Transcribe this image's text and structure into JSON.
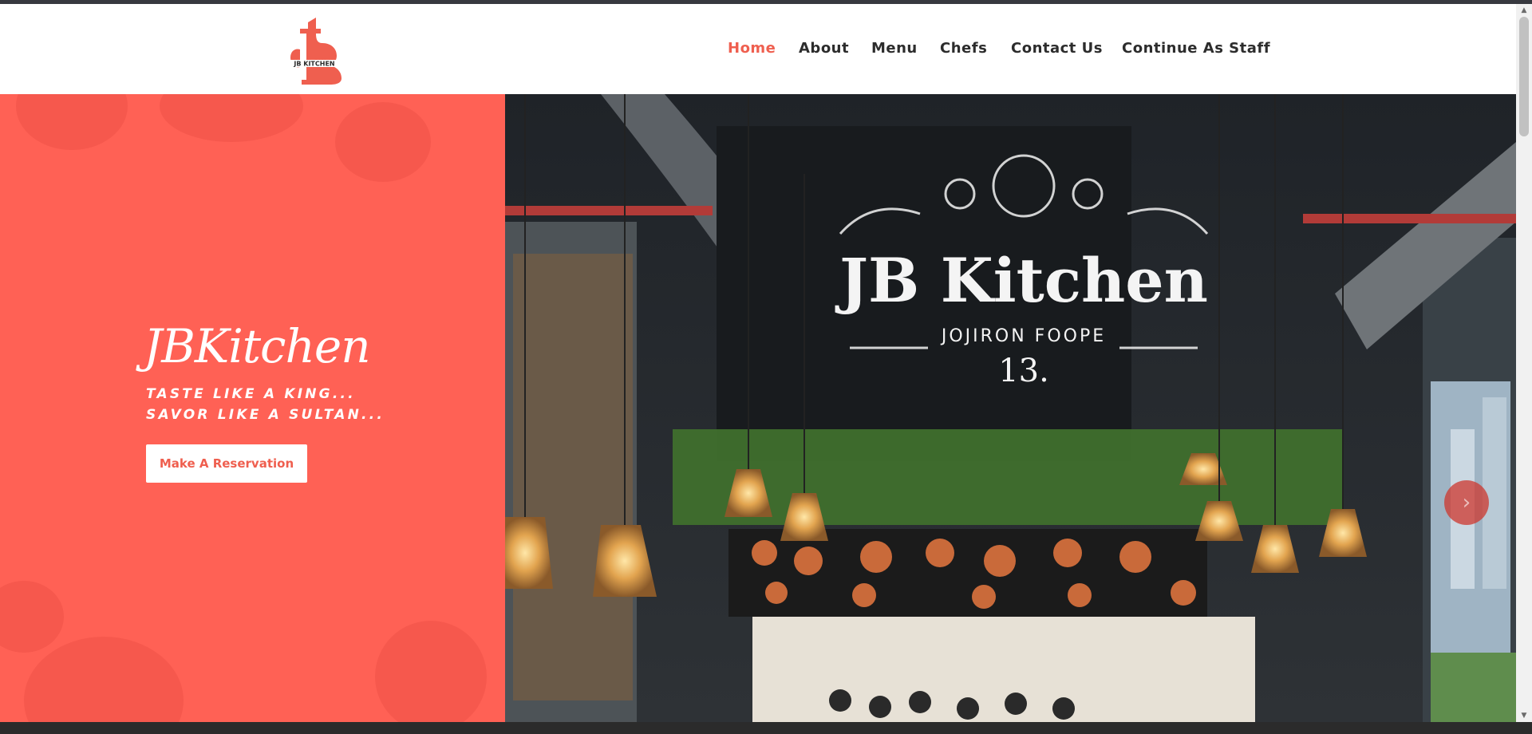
{
  "colors": {
    "accent": "#ef5f4f",
    "hero_panel": "#ff6155",
    "nav_text": "#2c2c2c"
  },
  "header": {
    "logo": {
      "text": "JB KITCHEN",
      "icon": "jb-kitchen-logo"
    },
    "nav": [
      {
        "label": "Home",
        "active": true
      },
      {
        "label": "About",
        "active": false
      },
      {
        "label": "Menu",
        "active": false
      },
      {
        "label": "Chefs",
        "active": false
      },
      {
        "label": "Contact Us",
        "active": false
      },
      {
        "label": "Continue As Staff",
        "active": false
      }
    ]
  },
  "hero": {
    "title": "JBKitchen",
    "tagline_line1": "TASTE LIKE A KING...",
    "tagline_line2": "SAVOR LIKE A SULTAN...",
    "cta_label": "Make A Reservation",
    "image": {
      "sign_title": "JB Kitchen",
      "sign_subtitle": "JOJIRON FOOPE",
      "sign_line": "13."
    },
    "next_icon": "chevron-right-icon"
  }
}
